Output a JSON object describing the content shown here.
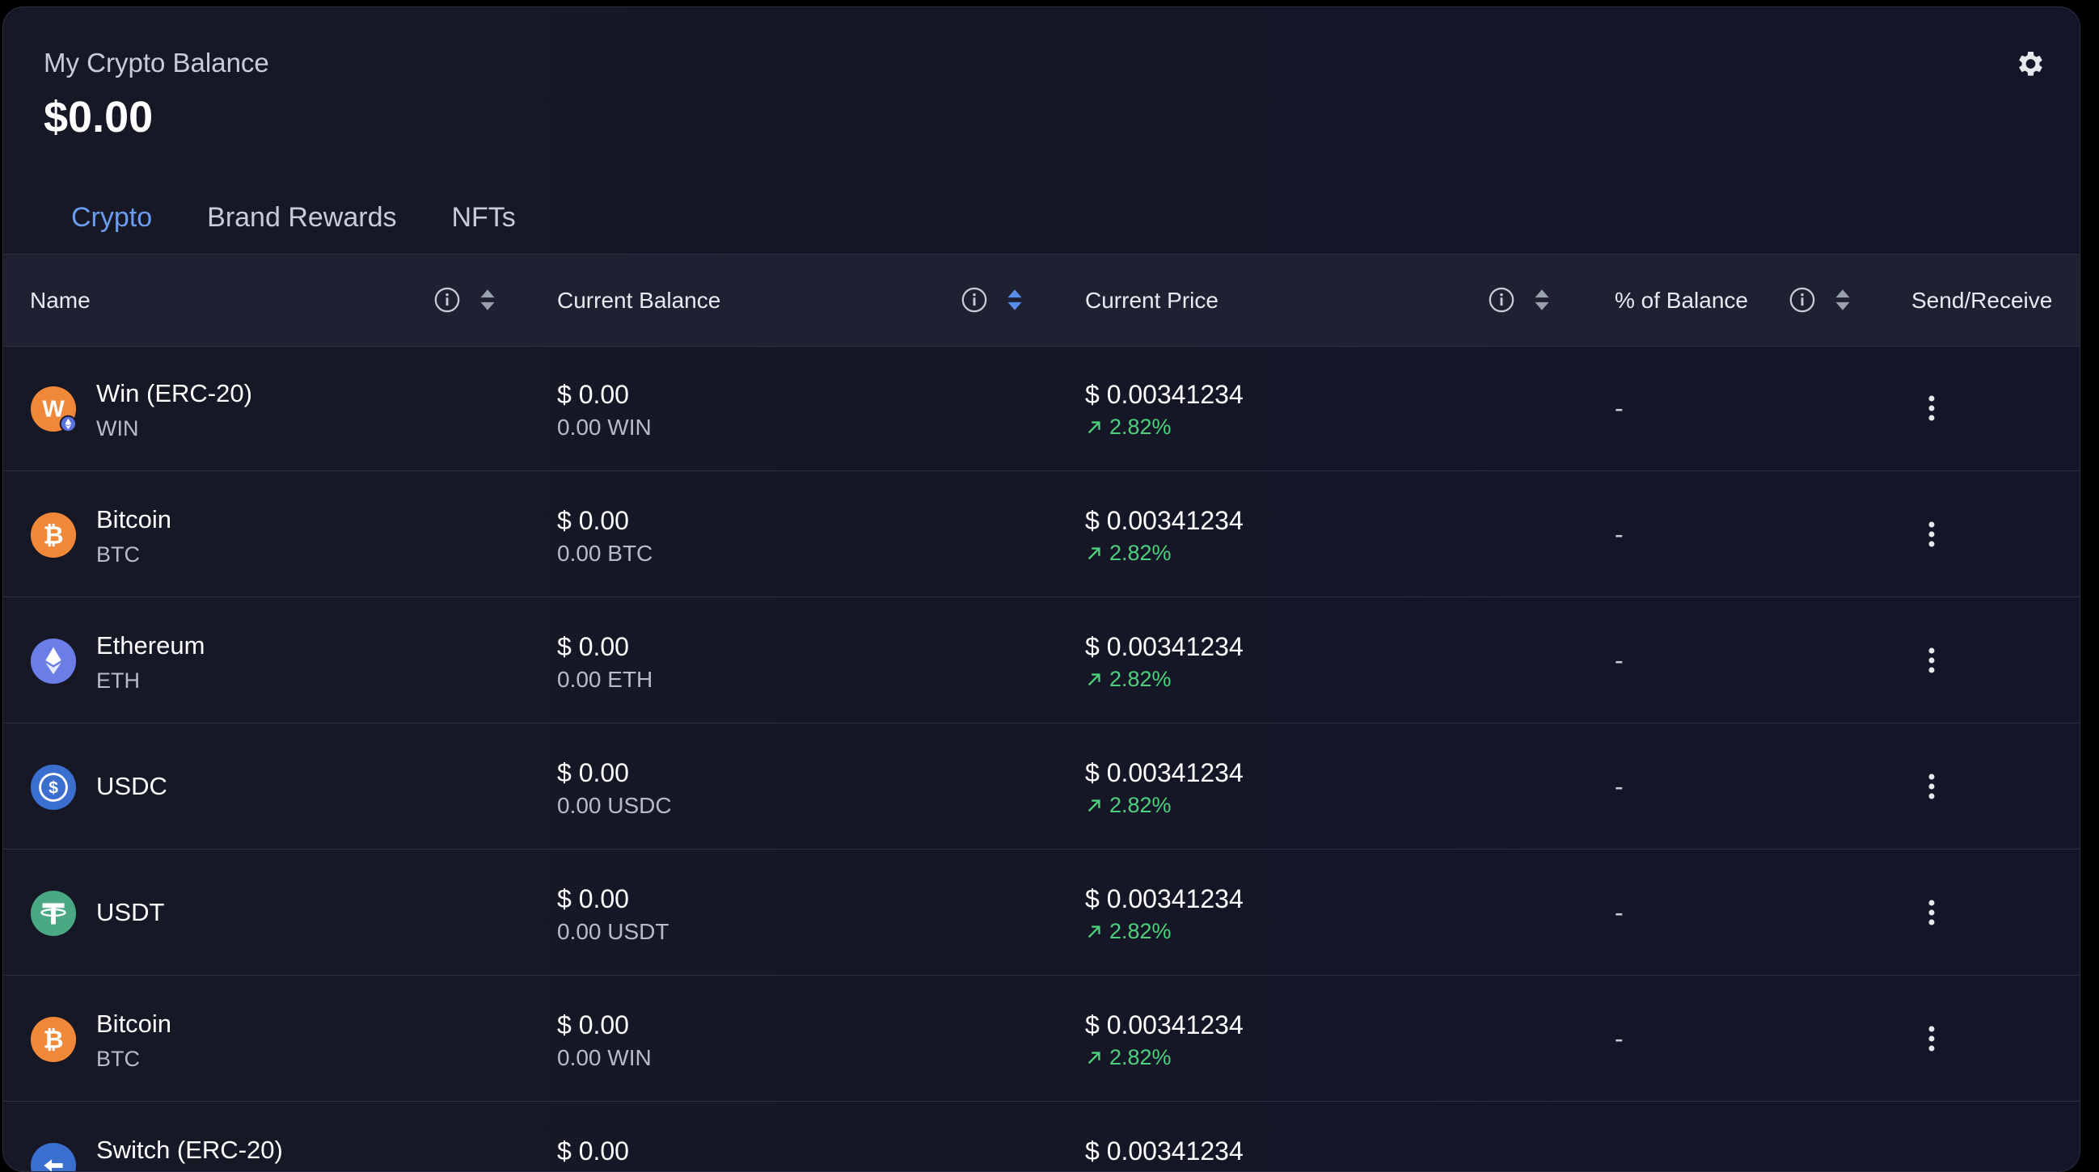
{
  "header": {
    "title": "My Crypto Balance",
    "balance": "$0.00"
  },
  "tabs": [
    {
      "label": "Crypto",
      "active": true
    },
    {
      "label": "Brand Rewards",
      "active": false
    },
    {
      "label": "NFTs",
      "active": false
    }
  ],
  "table": {
    "columns": [
      {
        "label": "Name",
        "sort": "none"
      },
      {
        "label": "Current Balance",
        "sort": "active"
      },
      {
        "label": "Current Price",
        "sort": "none"
      },
      {
        "label": "% of Balance",
        "sort": "none"
      },
      {
        "label": "Send/Receive"
      }
    ],
    "rows": [
      {
        "name": "Win (ERC-20)",
        "symbol": "WIN",
        "icon": "win-coin-icon",
        "balance": "$ 0.00",
        "balance_sub": "0.00 WIN",
        "price": "$ 0.00341234",
        "change": "2.82%",
        "pct": "-"
      },
      {
        "name": "Bitcoin",
        "symbol": "BTC",
        "icon": "bitcoin-icon",
        "balance": "$ 0.00",
        "balance_sub": "0.00 BTC",
        "price": "$ 0.00341234",
        "change": "2.82%",
        "pct": "-"
      },
      {
        "name": "Ethereum",
        "symbol": "ETH",
        "icon": "ethereum-icon",
        "balance": "$ 0.00",
        "balance_sub": "0.00 ETH",
        "price": "$ 0.00341234",
        "change": "2.82%",
        "pct": "-"
      },
      {
        "name": "USDC",
        "symbol": "",
        "icon": "usdc-icon",
        "balance": "$ 0.00",
        "balance_sub": "0.00 USDC",
        "price": "$ 0.00341234",
        "change": "2.82%",
        "pct": "-"
      },
      {
        "name": "USDT",
        "symbol": "",
        "icon": "usdt-icon",
        "balance": "$ 0.00",
        "balance_sub": "0.00 USDT",
        "price": "$ 0.00341234",
        "change": "2.82%",
        "pct": "-"
      },
      {
        "name": "Bitcoin",
        "symbol": "BTC",
        "icon": "bitcoin-icon",
        "balance": "$ 0.00",
        "balance_sub": "0.00 WIN",
        "price": "$ 0.00341234",
        "change": "2.82%",
        "pct": "-"
      },
      {
        "name": "Switch (ERC-20)",
        "symbol": "",
        "icon": "switch-coin-icon",
        "balance": "$ 0.00",
        "balance_sub": "",
        "price": "$ 0.00341234",
        "change": "",
        "pct": ""
      }
    ]
  },
  "colors": {
    "accent": "#5a8de8",
    "positive": "#4ed17c",
    "bitcoin": "#f0883a",
    "ethereum": "#6b7de6",
    "usdc": "#3a6fd0",
    "usdt": "#4aa882",
    "win": "#f0883a"
  }
}
